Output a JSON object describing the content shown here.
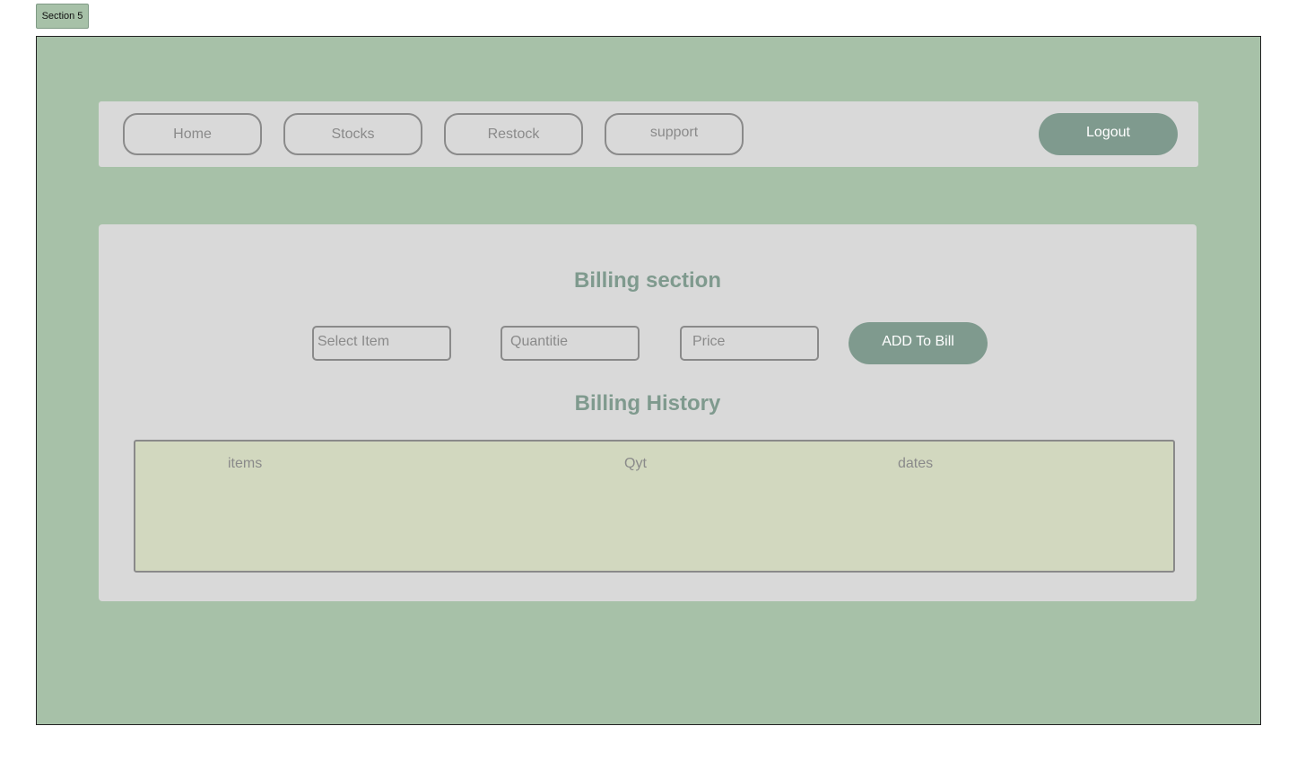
{
  "section_tag": "Section 5",
  "nav": {
    "home": "Home",
    "stocks": "Stocks",
    "restock": "Restock",
    "support": "support",
    "logout": "Logout"
  },
  "billing": {
    "title": "Billing section",
    "select_item_placeholder": "Select Item",
    "quantity_placeholder": "Quantitie",
    "price_placeholder": "Price",
    "add_button": "ADD To Bill"
  },
  "history": {
    "title": "Billing History",
    "columns": [
      "items",
      "Qyt",
      "dates"
    ]
  },
  "colors": {
    "background": "#a7c1a8",
    "panel": "#d9d9d9",
    "accent": "#7f9a8e",
    "table_bg": "#d2d8bf"
  }
}
